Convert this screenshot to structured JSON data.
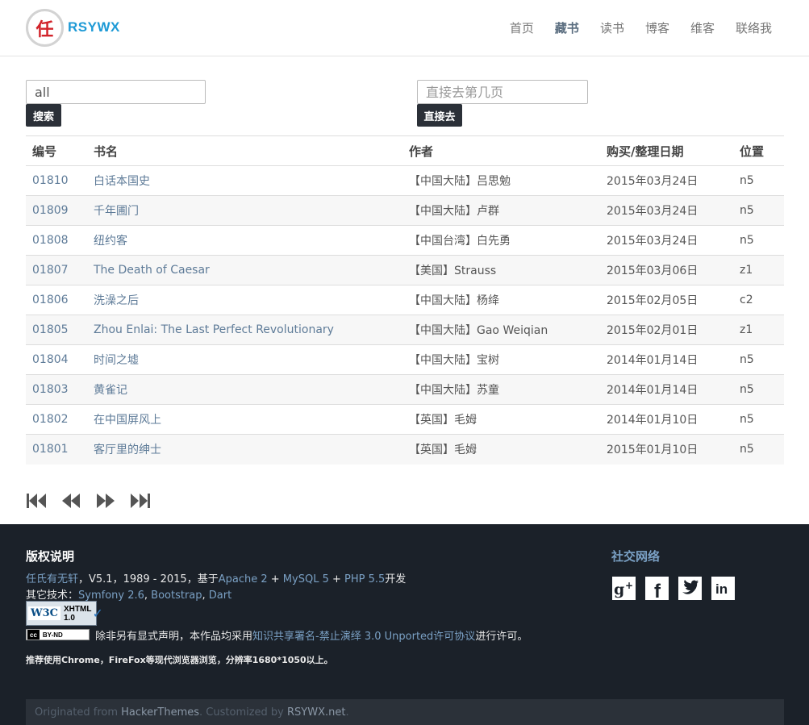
{
  "header": {
    "logo_char": "任",
    "brand": "RSYWX",
    "nav": [
      {
        "label": "首页",
        "active": false
      },
      {
        "label": "藏书",
        "active": true
      },
      {
        "label": "读书",
        "active": false
      },
      {
        "label": "博客",
        "active": false
      },
      {
        "label": "维客",
        "active": false
      },
      {
        "label": "联络我",
        "active": false
      }
    ]
  },
  "search": {
    "value": "all",
    "button": "搜索",
    "page_placeholder": "直接去第几页",
    "page_button": "直接去"
  },
  "table": {
    "headers": [
      "编号",
      "书名",
      "作者",
      "购买/整理日期",
      "位置"
    ],
    "rows": [
      {
        "id": "01810",
        "title": "白话本国史",
        "author": "【中国大陆】吕思勉",
        "date": "2015年03月24日",
        "loc": "n5"
      },
      {
        "id": "01809",
        "title": "千年圃门",
        "author": "【中国大陆】卢群",
        "date": "2015年03月24日",
        "loc": "n5"
      },
      {
        "id": "01808",
        "title": "纽约客",
        "author": "【中国台湾】白先勇",
        "date": "2015年03月24日",
        "loc": "n5"
      },
      {
        "id": "01807",
        "title": "The Death of Caesar",
        "author": "【美国】Strauss",
        "date": "2015年03月06日",
        "loc": "z1"
      },
      {
        "id": "01806",
        "title": "洗澡之后",
        "author": "【中国大陆】杨绛",
        "date": "2015年02月05日",
        "loc": "c2"
      },
      {
        "id": "01805",
        "title": "Zhou Enlai: The Last Perfect Revolutionary",
        "author": "【中国大陆】Gao Weiqian",
        "date": "2015年02月01日",
        "loc": "z1"
      },
      {
        "id": "01804",
        "title": "时间之墟",
        "author": "【中国大陆】宝树",
        "date": "2014年01月14日",
        "loc": "n5"
      },
      {
        "id": "01803",
        "title": "黄雀记",
        "author": "【中国大陆】苏童",
        "date": "2014年01月14日",
        "loc": "n5"
      },
      {
        "id": "01802",
        "title": "在中国屏风上",
        "author": "【英国】毛姆",
        "date": "2014年01月10日",
        "loc": "n5"
      },
      {
        "id": "01801",
        "title": "客厅里的绅士",
        "author": "【英国】毛姆",
        "date": "2015年01月10日",
        "loc": "n5"
      }
    ]
  },
  "pager": {
    "first": "first-page-icon",
    "prev": "previous-page-icon",
    "next": "next-page-icon",
    "last": "last-page-icon"
  },
  "footer": {
    "copyright_title": "版权说明",
    "line1": {
      "owner": "任氏有无轩",
      "mid": "，V5.1，1989 - 2015，基于",
      "apache": "Apache 2",
      "plus1": " + ",
      "mysql": "MySQL 5",
      "plus2": " + ",
      "php": "PHP 5.5",
      "end": "开发"
    },
    "line2": {
      "prefix": "其它技术：",
      "symfony": "Symfony 2.6",
      "sep1": ", ",
      "bootstrap": "Bootstrap",
      "sep2": ", ",
      "dart": "Dart"
    },
    "w3c": {
      "w3": "W3C",
      "xhtml": "XHTML",
      "version": "1.0"
    },
    "cc": {
      "left": "cc",
      "right": "BY-ND"
    },
    "license": {
      "prefix": "除非另有显式声明，本作品均采用",
      "link": "知识共享署名-禁止演绎 3.0 Unported许可协议",
      "suffix": "进行许可。"
    },
    "recommend": "推荐使用Chrome，FireFox等现代浏览器浏览，分辨率1680*1050以上。",
    "social_title": "社交网络",
    "social": [
      "google-plus-icon",
      "facebook-icon",
      "twitter-icon",
      "linkedin-icon"
    ],
    "bottom": {
      "prefix": "Originated from ",
      "hacker": "HackerThemes",
      "mid": ". Customized by ",
      "rsywx": "RSYWX.net",
      "end": "."
    }
  },
  "colors": {
    "brand": "#1e9ad6",
    "link": "#5e7b98",
    "footer_bg": "#1b2129",
    "button_bg": "#2b3038"
  }
}
